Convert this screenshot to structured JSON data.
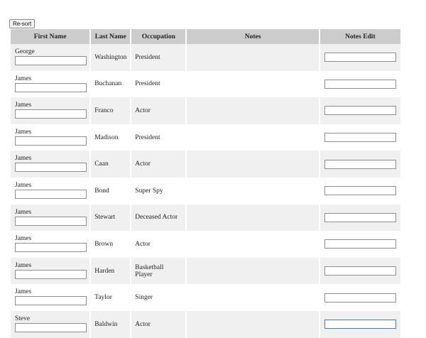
{
  "toolbar": {
    "resort_label": "Re-sort"
  },
  "table": {
    "headers": {
      "first": "First Name",
      "last": "Last Name",
      "occupation": "Occupation",
      "notes": "Notes",
      "notes_edit": "Notes Edit"
    },
    "rows": [
      {
        "first": "George",
        "last": "Washington",
        "occupation": "President"
      },
      {
        "first": "James",
        "last": "Buchanan",
        "occupation": "President"
      },
      {
        "first": "James",
        "last": "Franco",
        "occupation": "Actor"
      },
      {
        "first": "James",
        "last": "Madison",
        "occupation": "President"
      },
      {
        "first": "James",
        "last": "Caan",
        "occupation": "Actor"
      },
      {
        "first": "James",
        "last": "Bond",
        "occupation": "Super Spy"
      },
      {
        "first": "James",
        "last": "Stewart",
        "occupation": "Deceased Actor"
      },
      {
        "first": "James",
        "last": "Brown",
        "occupation": "Actor"
      },
      {
        "first": "James",
        "last": "Harden",
        "occupation": "Basketball Player"
      },
      {
        "first": "James",
        "last": "Taylor",
        "occupation": "Singer"
      },
      {
        "first": "Steve",
        "last": "Baldwin",
        "occupation": "Actor"
      }
    ]
  },
  "colors": {
    "header_bg": "#cccccc",
    "row_alt_bg": "#f0f0f0",
    "focus_border": "#4a78c8"
  }
}
